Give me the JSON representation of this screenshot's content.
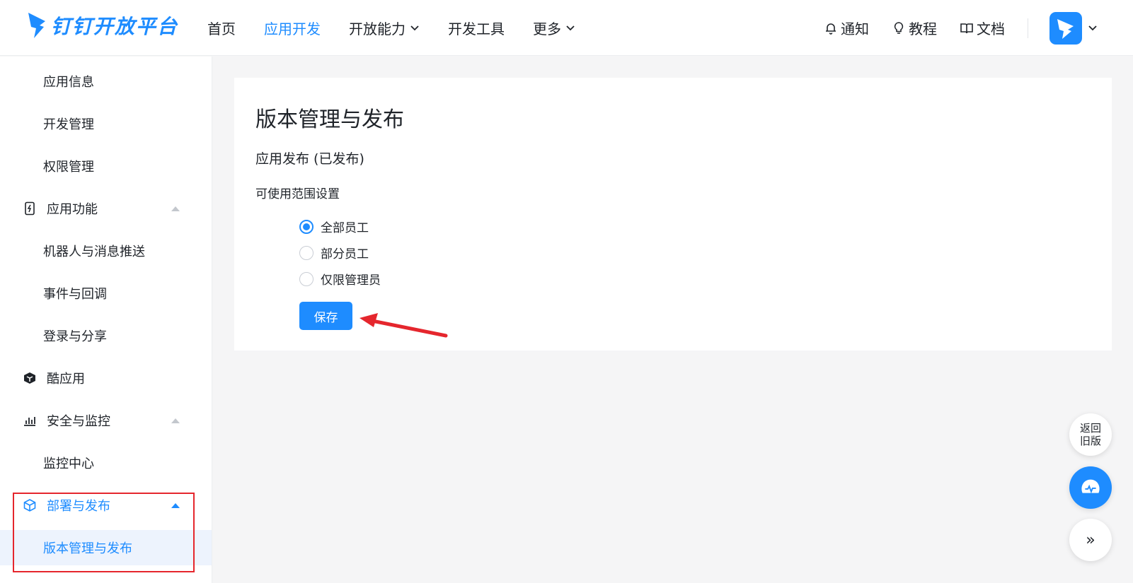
{
  "header": {
    "logo_text": "钉钉开放平台",
    "nav": [
      {
        "label": "首页"
      },
      {
        "label": "应用开发"
      },
      {
        "label": "开放能力"
      },
      {
        "label": "开发工具"
      },
      {
        "label": "更多"
      }
    ],
    "active_nav": "应用开发",
    "links": {
      "notify": "通知",
      "tutorial": "教程",
      "docs": "文档"
    }
  },
  "sidebar": {
    "items": [
      {
        "label": "应用信息",
        "kind": "sub"
      },
      {
        "label": "开发管理",
        "kind": "sub"
      },
      {
        "label": "权限管理",
        "kind": "sub"
      },
      {
        "label": "应用功能",
        "kind": "group",
        "icon": "phone-bolt-icon",
        "expanded": true
      },
      {
        "label": "机器人与消息推送",
        "kind": "sub"
      },
      {
        "label": "事件与回调",
        "kind": "sub"
      },
      {
        "label": "登录与分享",
        "kind": "sub"
      },
      {
        "label": "酷应用",
        "kind": "group",
        "icon": "cube-app-icon"
      },
      {
        "label": "安全与监控",
        "kind": "group",
        "icon": "bar-chart-icon",
        "expanded": true
      },
      {
        "label": "监控中心",
        "kind": "sub"
      },
      {
        "label": "部署与发布",
        "kind": "group",
        "icon": "box-icon",
        "expanded": true,
        "open": true
      },
      {
        "label": "版本管理与发布",
        "kind": "sub",
        "active": true
      }
    ]
  },
  "main": {
    "page_title": "版本管理与发布",
    "section_title": "应用发布 (已发布)",
    "scope_title": "可使用范围设置",
    "scope_options": [
      {
        "label": "全部员工",
        "checked": true
      },
      {
        "label": "部分员工",
        "checked": false
      },
      {
        "label": "仅限管理员",
        "checked": false
      }
    ],
    "save_label": "保存"
  },
  "floating": {
    "back_line1": "返回",
    "back_line2": "旧版",
    "expand_glyph": "»"
  },
  "colors": {
    "accent": "#1e8cff",
    "annotation_red": "#e5262d",
    "active_bg": "#edf3fd",
    "page_bg": "#f5f5f6"
  }
}
